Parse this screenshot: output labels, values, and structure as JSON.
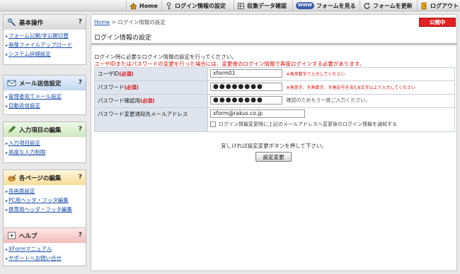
{
  "topnav": {
    "home": "Home",
    "login_settings": "ログイン情報の設定",
    "data_check": "収集データ確認",
    "www_badge": "WWW",
    "view_form": "フォームを見る",
    "update_form": "フォームを更新",
    "logout": "ログアウト"
  },
  "sidebar": {
    "help_glyph": "?",
    "basic": {
      "title": "基本操作",
      "items": [
        "フォーム公開/非公開切替",
        "画像ファイルアップロード",
        "システム詳細設定"
      ]
    },
    "mail": {
      "title": "メール送信設定",
      "items": [
        "管理者宛てメール設定",
        "自動返信設定"
      ]
    },
    "input": {
      "title": "入力項目の編集",
      "items": [
        "入力項目設定",
        "高度な入力制限"
      ]
    },
    "pages": {
      "title": "各ページの編集",
      "items": [
        "各画面設定",
        "PC用ヘッダ・フッタ編集",
        "携帯用ヘッダ・フッタ編集"
      ]
    },
    "help": {
      "title": "ヘルプ",
      "items": [
        "XFormマニュアル",
        "サポートへお問い合せ"
      ]
    }
  },
  "main": {
    "breadcrumb_home": "Home",
    "breadcrumb_sep": " > ",
    "breadcrumb_current": "ログイン情報の設定",
    "status_badge": "公開中",
    "title": "ログイン情報の設定",
    "intro": "ログイン時に必要なログイン情報の設定を行ってください。",
    "warning": "ユーザIDまたはパスワードの変更を行った場合には、変更後のログイン情報で再度ログインする必要があります。",
    "required_mark": "(必須)",
    "userid": {
      "label": "ユーザID",
      "value": "xform01",
      "hint": "※角英数字で入力してください"
    },
    "password": {
      "label": "パスワード",
      "value": "●●●●●●●●",
      "hint": "※角英字、半角数字、半角記号を含む8文字以上で入力してください"
    },
    "password_confirm": {
      "label": "パスワード確認用",
      "value": "●●●●●●●●",
      "hint": "確認のためもう一度ご入力ください。"
    },
    "notify_email": {
      "label": "パスワード変更通知先メールアドレス",
      "value": "xform@rakus.co.jp",
      "checkbox_label": "ログイン情報変更時に上記のメールアドレスへ変更後のログイン情報を通知する"
    },
    "confirm_text": "宜しければ設定変更ボタンを押して下さい。",
    "submit_label": "設定変更"
  },
  "colors": {
    "accent_red": "#d21010",
    "badge_red": "#e02222",
    "link_blue": "#1a4fa8",
    "label_bg": "#dfe4ee",
    "basic_head": "#e3e3e3",
    "mail_head": "#d4e3f5",
    "input_head": "#dcefd0",
    "pages_head": "#fbecc4",
    "help_head": "#f8d3d3"
  }
}
